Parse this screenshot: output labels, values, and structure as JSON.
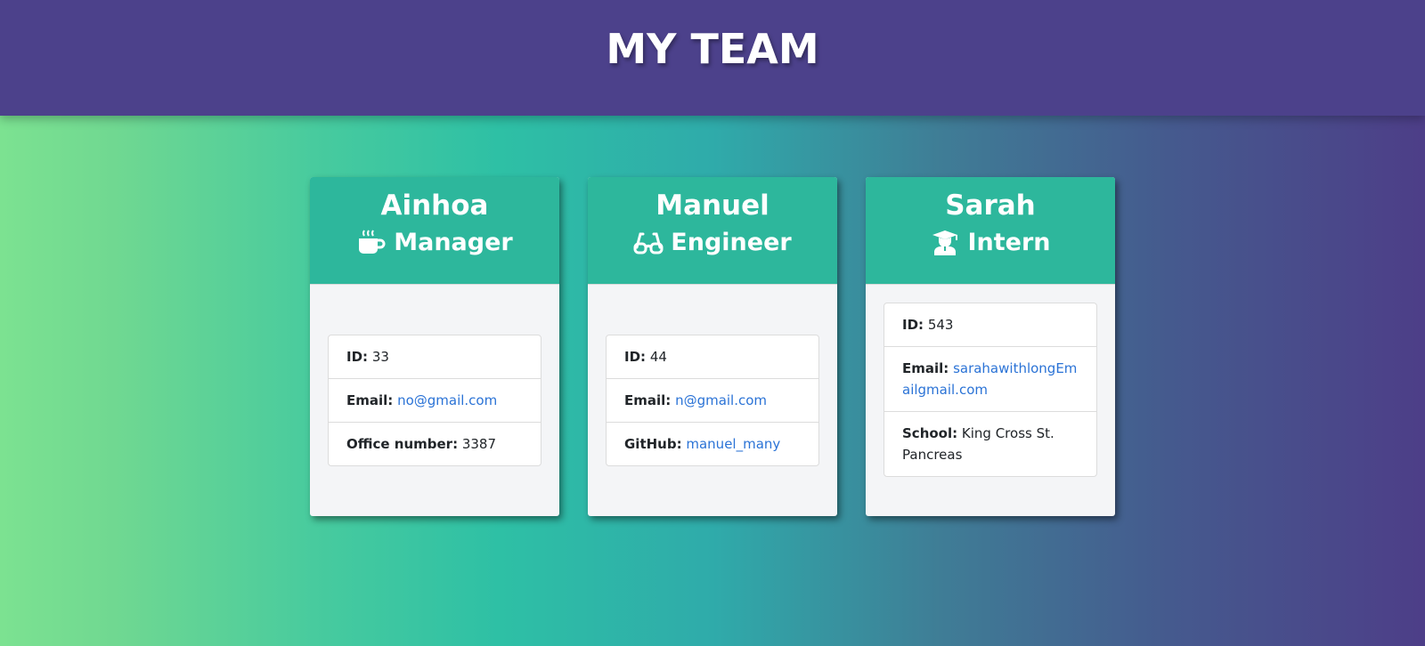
{
  "header": {
    "title": "MY TEAM"
  },
  "cards": [
    {
      "name": "Ainhoa",
      "role": "Manager",
      "icon": "coffee-mug-icon",
      "rows": [
        {
          "label": "ID:",
          "value": "33"
        },
        {
          "label": "Email:",
          "value": "no@gmail.com"
        },
        {
          "label": "Office number:",
          "value": "3387"
        }
      ]
    },
    {
      "name": "Manuel",
      "role": "Engineer",
      "icon": "glasses-icon",
      "rows": [
        {
          "label": "ID:",
          "value": "44"
        },
        {
          "label": "Email:",
          "value": "n@gmail.com"
        },
        {
          "label": "GitHub:",
          "value": "manuel_many"
        }
      ]
    },
    {
      "name": "Sarah",
      "role": "Intern",
      "icon": "graduate-icon",
      "rows": [
        {
          "label": "ID:",
          "value": "543"
        },
        {
          "label": "Email:",
          "value": "sarahawithlongEmailgmail.com"
        },
        {
          "label": "School:",
          "value": "King Cross St. Pancreas"
        }
      ]
    }
  ],
  "colors": {
    "header_bg": "#4c418b",
    "card_head_bg": "#2db79c",
    "link": "#2b73d6"
  }
}
